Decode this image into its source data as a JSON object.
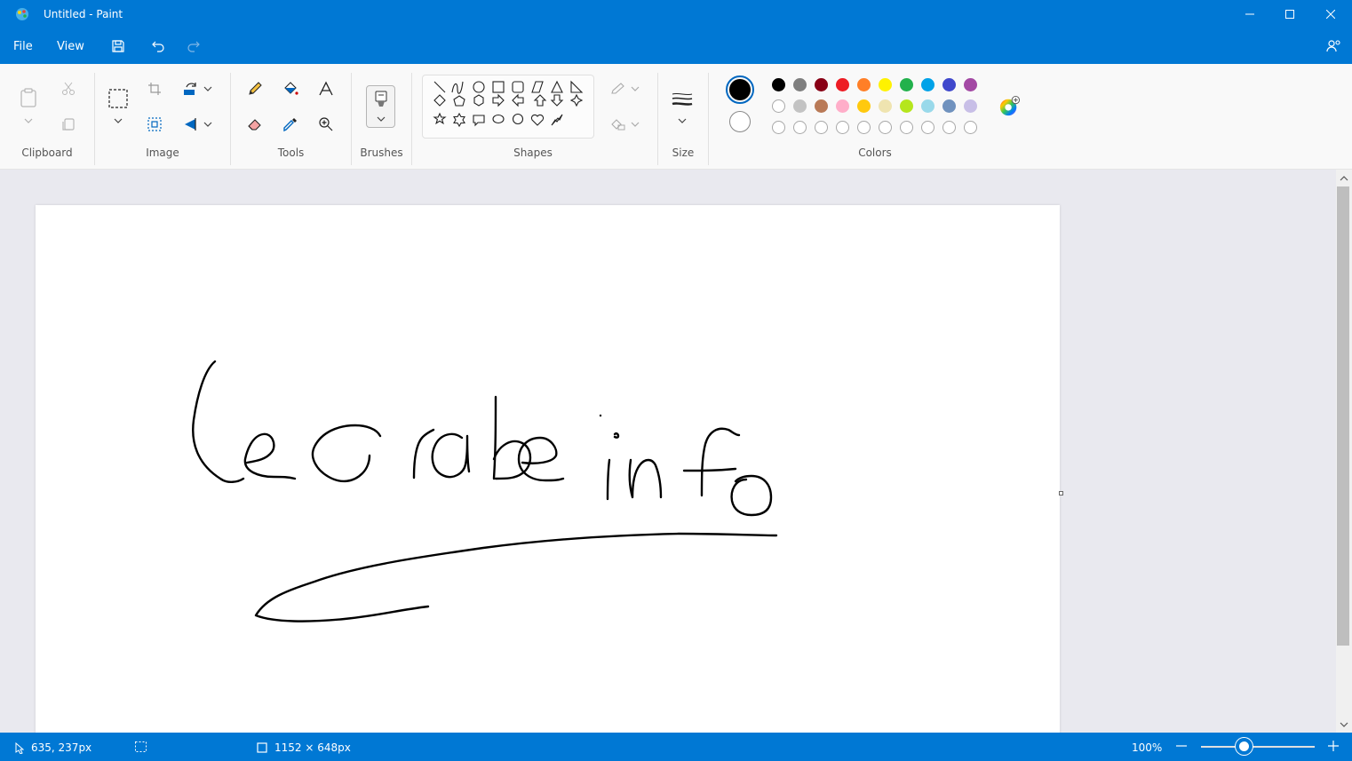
{
  "window": {
    "title": "Untitled - Paint"
  },
  "menu": {
    "file": "File",
    "view": "View"
  },
  "ribbon": {
    "groups": {
      "clipboard": "Clipboard",
      "image": "Image",
      "tools": "Tools",
      "brushes": "Brushes",
      "shapes": "Shapes",
      "size": "Size",
      "colors": "Colors"
    },
    "palette_row1": [
      "#000000",
      "#7f7f7f",
      "#880015",
      "#ed1c24",
      "#ff7f27",
      "#fff200",
      "#22b14c",
      "#00a2e8",
      "#3f48cc",
      "#a349a4"
    ],
    "palette_row2": [
      "#ffffff",
      "#c3c3c3",
      "#b97a57",
      "#ffaec9",
      "#ffc90e",
      "#efe4b0",
      "#b5e61d",
      "#99d9ea",
      "#7092be",
      "#c8bfe7"
    ],
    "primary_color": "#000000",
    "secondary_color": "#ffffff"
  },
  "status": {
    "cursor_position": "635, 237px",
    "canvas_size": "1152 × 648px",
    "zoom": "100%"
  }
}
